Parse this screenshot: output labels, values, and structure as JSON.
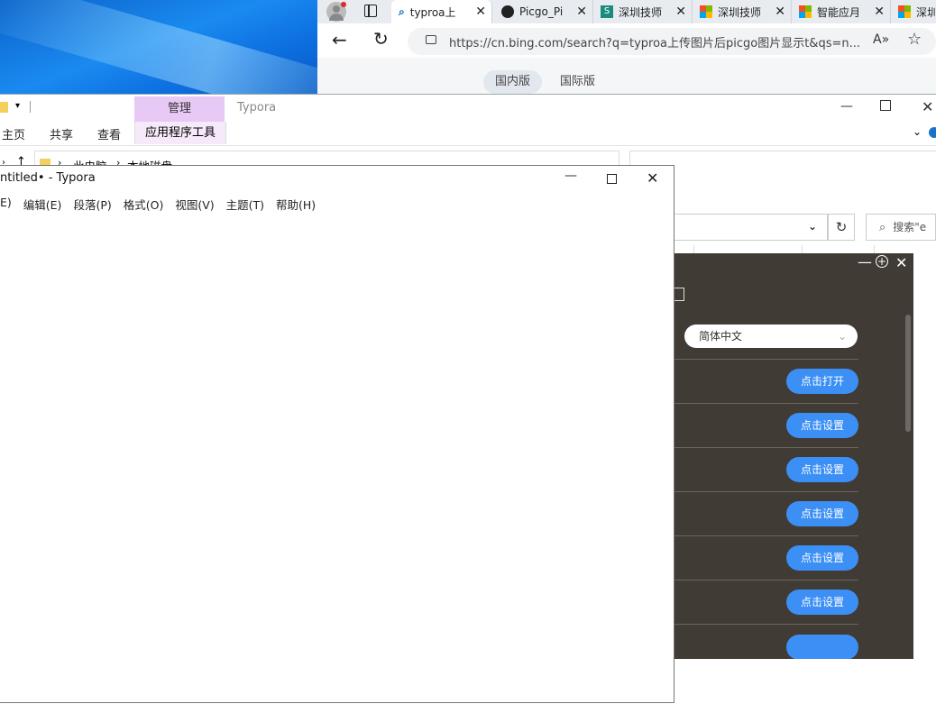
{
  "browser": {
    "tabs": [
      {
        "label": "typroa上"
      },
      {
        "label": "Picgo_Pi"
      },
      {
        "label": "深圳技师"
      },
      {
        "label": "深圳技师"
      },
      {
        "label": "智能应月"
      },
      {
        "label": "深圳"
      }
    ],
    "url": "https://cn.bing.com/search?q=typroa上传图片后picgo图片显示t&qs=n...",
    "page_tabs": [
      "国内版",
      "国际版"
    ],
    "accent": "#0067c0"
  },
  "explorer": {
    "manage_label": "管理",
    "app_label": "Typora",
    "tabs": [
      "主页",
      "共享",
      "查看"
    ],
    "app_tools_label": "应用程序工具",
    "breadcrumb": [
      "此电脑",
      "本地磁盘"
    ],
    "search_placeholder": "搜索\"e"
  },
  "typora": {
    "title": "ntitled• - Typora",
    "menu": [
      "E)",
      "编辑(E)",
      "段落(P)",
      "格式(O)",
      "视图(V)",
      "主题(T)",
      "帮助(H)"
    ]
  },
  "picgo": {
    "language": "简体中文",
    "buttons": [
      "点击打开",
      "点击设置",
      "点击设置",
      "点击设置",
      "点击设置",
      "点击设置"
    ],
    "bg_color": "#413b36",
    "button_color": "#3c8ff5"
  }
}
